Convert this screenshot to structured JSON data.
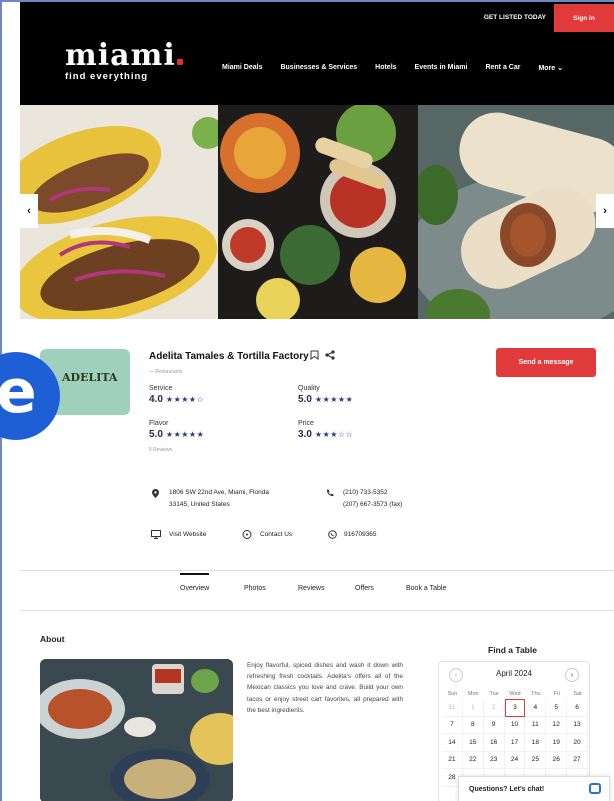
{
  "header": {
    "logo_word": "miami",
    "logo_tagline": "find everything",
    "get_listed": "GET LISTED TODAY",
    "sign_in": "Sign in",
    "nav": [
      "Miami Deals",
      "Businesses & Services",
      "Hotels",
      "Events in Miami",
      "Rent a Car",
      "More ⌄"
    ]
  },
  "gallery": {
    "prev_arrow": "‹",
    "next_arrow": "›"
  },
  "business": {
    "logo_text": "ADELITA",
    "name": "Adelita Tamales & Tortilla Factory",
    "category": "— Restaurants",
    "send_message": "Send a message",
    "ratings": [
      {
        "label": "Service",
        "value": "4.0",
        "stars": "★★★★☆"
      },
      {
        "label": "Quality",
        "value": "5.0",
        "stars": "★★★★★"
      },
      {
        "label": "Flavor",
        "value": "5.0",
        "stars": "★★★★★"
      },
      {
        "label": "Price",
        "value": "3.0",
        "stars": "★★★☆☆"
      }
    ],
    "reviews": "5 Reviews",
    "address_line1": "1806 SW 22nd Ave, Miami, Florida",
    "address_line2": "33145, United States",
    "phone": "(210) 733-5352",
    "fax": "(207) 667-3573 (fax)",
    "visit_website": "Visit Website",
    "contact_us": "Contact Us",
    "whatsapp": "916709365"
  },
  "tabs": [
    "Overview",
    "Photos",
    "Reviews",
    "Offers",
    "Book a Table"
  ],
  "about": {
    "heading": "About",
    "text": "Enjoy flavorful, spiced dishes and wash it down with refreshing fresh cocktails. Adelita's offers all of the Mexican classics you love and crave. Build your own tacos or enjoy street cart favorites, all prepared with the best ingredients."
  },
  "find_table": {
    "heading": "Find a Table",
    "month": "April  2024",
    "weekdays": [
      "Sun",
      "Mon",
      "Tue",
      "Wed",
      "Thu",
      "Fri",
      "Sat"
    ],
    "days": [
      "31",
      "1",
      "2",
      "3",
      "4",
      "5",
      "6",
      "7",
      "8",
      "9",
      "10",
      "11",
      "12",
      "13",
      "14",
      "15",
      "16",
      "17",
      "18",
      "19",
      "20",
      "21",
      "22",
      "23",
      "24",
      "25",
      "26",
      "27",
      "28",
      "",
      "",
      "",
      "",
      "",
      ""
    ],
    "selected_day": "3"
  },
  "chat": {
    "label": "Questions? Let's chat!"
  },
  "badge": {
    "letter": "e"
  }
}
